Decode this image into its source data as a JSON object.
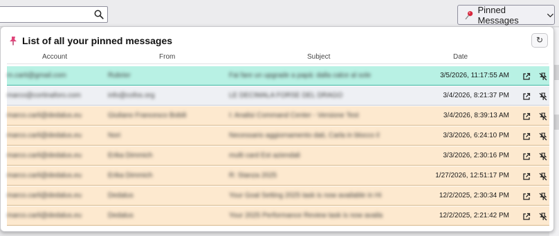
{
  "toolbar": {
    "search_value": "",
    "pinned_button_label": "Pinned Messages"
  },
  "panel": {
    "title": "List of all your pinned messages",
    "refresh_label": "↻",
    "columns": {
      "account": "Account",
      "from": "From",
      "subject": "Subject",
      "date": "Date"
    },
    "rows": [
      {
        "account": "m.carti@gmail.com",
        "from": "Rubrier",
        "subject": "Fai fare un upgrade a papà: dalla calce al sole",
        "date": "3/5/2026, 11:17:55 AM",
        "style": "sel"
      },
      {
        "account": "marco@cortinaforo.com",
        "from": "info@cofos.org",
        "subject": "LE DECIMALA FORSE DEL DRAGO",
        "date": "3/4/2026, 8:21:37 PM",
        "style": "gray"
      },
      {
        "account": "marco.carli@dedalus.eu",
        "from": "Giuliano Francesco Bobili",
        "subject": "I: Analisi Command Center - Versione Test",
        "date": "3/4/2026, 8:39:13 AM",
        "style": "orange"
      },
      {
        "account": "marco.carli@dedalus.eu",
        "from": "Nori",
        "subject": "Necessario aggiornamento dati, Carla in blocco il",
        "date": "3/3/2026, 6:24:10 PM",
        "style": "orange"
      },
      {
        "account": "marco.carli@dedalus.eu",
        "from": "Erika Dimmich",
        "subject": "multi card Est aziendali",
        "date": "3/3/2026, 2:30:16 PM",
        "style": "orange"
      },
      {
        "account": "marco.carli@dedalus.eu",
        "from": "Erika Dimmich",
        "subject": "R: Stanza 2025",
        "date": "1/27/2026, 12:51:17 PM",
        "style": "orange"
      },
      {
        "account": "marco.carli@dedalus.eu",
        "from": "Dedalus",
        "subject": "Your Goal Setting 2025 task is now available in Hi",
        "date": "12/2/2025, 2:30:34 PM",
        "style": "orange"
      },
      {
        "account": "marco.carli@dedalus.eu",
        "from": "Dedalus",
        "subject": "Your 2025 Performance Review task is now availa",
        "date": "12/2/2025, 2:21:42 PM",
        "style": "orange"
      }
    ]
  },
  "icons": {
    "search": "search-icon",
    "pin": "pushpin-icon",
    "chevron": "chevron-down-icon",
    "open": "open-external-icon",
    "unpin": "unpin-icon"
  },
  "colors": {
    "selected_row": "#b8f1e4",
    "gray_row": "#eef0f4",
    "orange_row": "#fde9cf",
    "pin_red": "#d7263d"
  }
}
